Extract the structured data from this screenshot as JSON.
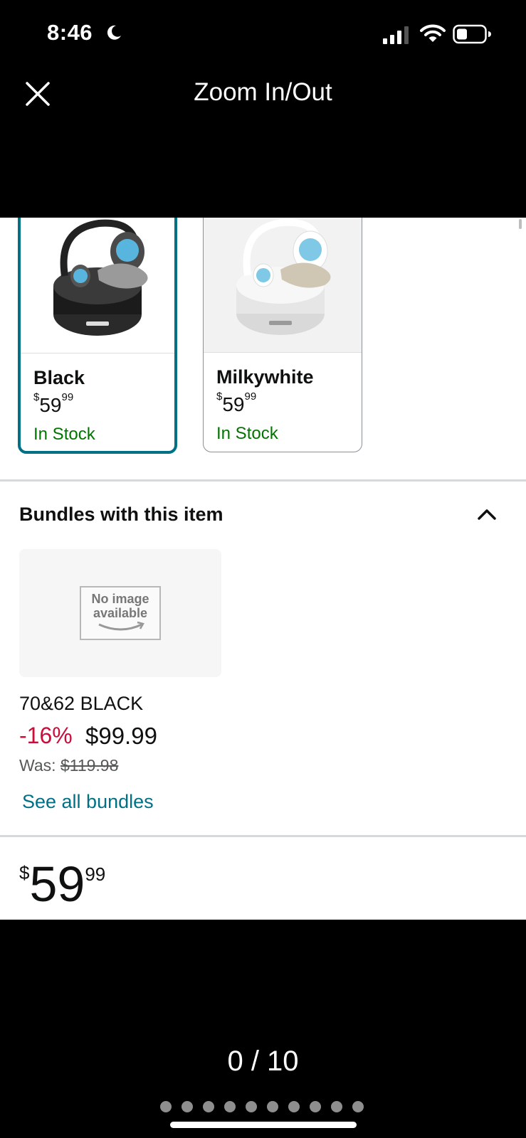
{
  "status_bar": {
    "time": "8:46"
  },
  "header": {
    "title": "Zoom In/Out"
  },
  "swatches": [
    {
      "name": "Black",
      "price_currency": "$",
      "price_whole": "59",
      "price_fraction": "99",
      "stock": "In Stock",
      "selected": true
    },
    {
      "name": "Milkywhite",
      "price_currency": "$",
      "price_whole": "59",
      "price_fraction": "99",
      "stock": "In Stock",
      "selected": false
    }
  ],
  "bundles": {
    "title": "Bundles with this item",
    "placeholder_line1": "No image",
    "placeholder_line2": "available",
    "item_name": "70&62 BLACK",
    "discount": "-16%",
    "price": "$99.99",
    "was_label": "Was:",
    "was_price": "$119.98",
    "see_all": "See all bundles"
  },
  "price": {
    "currency": "$",
    "whole": "59",
    "fraction": "99"
  },
  "pager": {
    "counter": "0 / 10",
    "total_dots": 10
  },
  "colors": {
    "accent": "#007185",
    "in_stock": "#007600",
    "discount": "#cc0c39"
  }
}
